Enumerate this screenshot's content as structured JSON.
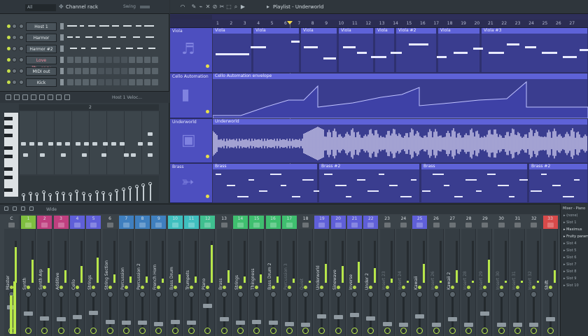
{
  "channel_rack": {
    "title": "Channel rack",
    "filter": "All",
    "swing_label": "Swing",
    "channels": [
      {
        "name": "Host 1",
        "color": "#e4e9ec"
      },
      {
        "name": "Harmor",
        "color": "#e4e9ec"
      },
      {
        "name": "Harmor #2",
        "color": "#e4e9ec"
      },
      {
        "name": "Love Ph...ency",
        "color": "#f28ea0"
      },
      {
        "name": "MIDI out",
        "color": "#e4e9ec"
      },
      {
        "name": "Kick",
        "color": "#e4e9ec"
      }
    ]
  },
  "piano_roll": {
    "title": "Host 1  Veloc...",
    "bar_labels": [
      "2"
    ]
  },
  "playlist": {
    "title": "Playlist - Underworld",
    "ruler": [
      "1",
      "2",
      "3",
      "4",
      "5",
      "6",
      "7",
      "8",
      "9",
      "10",
      "11",
      "12",
      "13",
      "14",
      "15",
      "16",
      "17",
      "18",
      "19",
      "20",
      "21",
      "22",
      "23",
      "24",
      "25",
      "26",
      "27"
    ],
    "tracks": [
      {
        "name": "Viola",
        "clips": [
          {
            "label": "Viola"
          },
          {
            "label": "Viola"
          },
          {
            "label": "Viola"
          },
          {
            "label": "Viola"
          },
          {
            "label": "Viola"
          },
          {
            "label": "Viola #2"
          },
          {
            "label": "Viola"
          },
          {
            "label": "Viola #3"
          }
        ]
      },
      {
        "name": "Cello Automation",
        "clips": [
          {
            "label": "Cello Automation envelope"
          }
        ]
      },
      {
        "name": "Underworld",
        "clips": [
          {
            "label": "Underworld"
          }
        ]
      },
      {
        "name": "Brass",
        "clips": [
          {
            "label": "Brass"
          },
          {
            "label": "Brass #2"
          },
          {
            "label": "Brass"
          },
          {
            "label": "Brass #2"
          }
        ]
      }
    ]
  },
  "mixer": {
    "title": "Wide",
    "tracks": [
      {
        "num": "C",
        "name": "Master",
        "level": 0.85
      },
      {
        "num": "1",
        "name": "Synth",
        "level": 0.55
      },
      {
        "num": "2",
        "name": "Synth Arp",
        "level": 0.35
      },
      {
        "num": "3",
        "name": "Additive",
        "level": 0.3
      },
      {
        "num": "4",
        "name": "Cello",
        "level": 0.4
      },
      {
        "num": "5",
        "name": "Strings",
        "level": 0.6
      },
      {
        "num": "6",
        "name": "String Section",
        "level": 0.2
      },
      {
        "num": "7",
        "name": "Percussion",
        "level": 0.15
      },
      {
        "num": "8",
        "name": "Percussion 2",
        "level": 0.15
      },
      {
        "num": "9",
        "name": "French Horn",
        "level": 0.1
      },
      {
        "num": "10",
        "name": "Bass Drum",
        "level": 0.2
      },
      {
        "num": "11",
        "name": "Trumpets",
        "level": 0.15
      },
      {
        "num": "12",
        "name": "Piano",
        "level": 0.9
      },
      {
        "num": "13",
        "name": "Brass",
        "level": 0.3
      },
      {
        "num": "14",
        "name": "Strings",
        "level": 0.15
      },
      {
        "num": "15",
        "name": "Thingness",
        "level": 0.2
      },
      {
        "num": "16",
        "name": "Bass Drum 2",
        "level": 0.15
      },
      {
        "num": "17",
        "name": "Percussion 3",
        "level": 0.1
      },
      {
        "num": "18",
        "name": "Quiet",
        "level": 0.05
      },
      {
        "num": "19",
        "name": "Underworld",
        "level": 0.45
      },
      {
        "num": "20",
        "name": "Sinewave",
        "level": 0.4
      },
      {
        "num": "21",
        "name": "Inverse",
        "level": 0.5
      },
      {
        "num": "22",
        "name": "Under 2",
        "level": 0.35
      },
      {
        "num": "23",
        "name": "Insert 23",
        "level": 0.1
      },
      {
        "num": "24",
        "name": "Insert 24",
        "level": 0.05
      },
      {
        "num": "25",
        "name": "Kawaii",
        "level": 0.45
      },
      {
        "num": "26",
        "name": "Insert 26",
        "level": 0.05
      },
      {
        "num": "27",
        "name": "Kawaii 2",
        "level": 0.3
      },
      {
        "num": "28",
        "name": "Insert 28",
        "level": 0.05
      },
      {
        "num": "29",
        "name": "Insert 29",
        "level": 0.55
      },
      {
        "num": "30",
        "name": "Insert 30",
        "level": 0.05
      },
      {
        "num": "31",
        "name": "Insert 31",
        "level": 0.05
      },
      {
        "num": "32",
        "name": "Insert 32",
        "level": 0.05
      },
      {
        "num": "33",
        "name": "Shift",
        "level": 0.3
      }
    ]
  },
  "browser": {
    "title": "Mixer - Piano",
    "items": [
      "(none)",
      "Slot 1",
      "Maximus",
      "Fruity parametric",
      "Slot 4",
      "Slot 5",
      "Slot 6",
      "Slot 7",
      "Slot 8",
      "Slot 9",
      "Slot 10"
    ]
  },
  "colors": {
    "playlist_bg": "#2f3170",
    "clip": "#5e62d8",
    "accent": "#b7e64a"
  }
}
